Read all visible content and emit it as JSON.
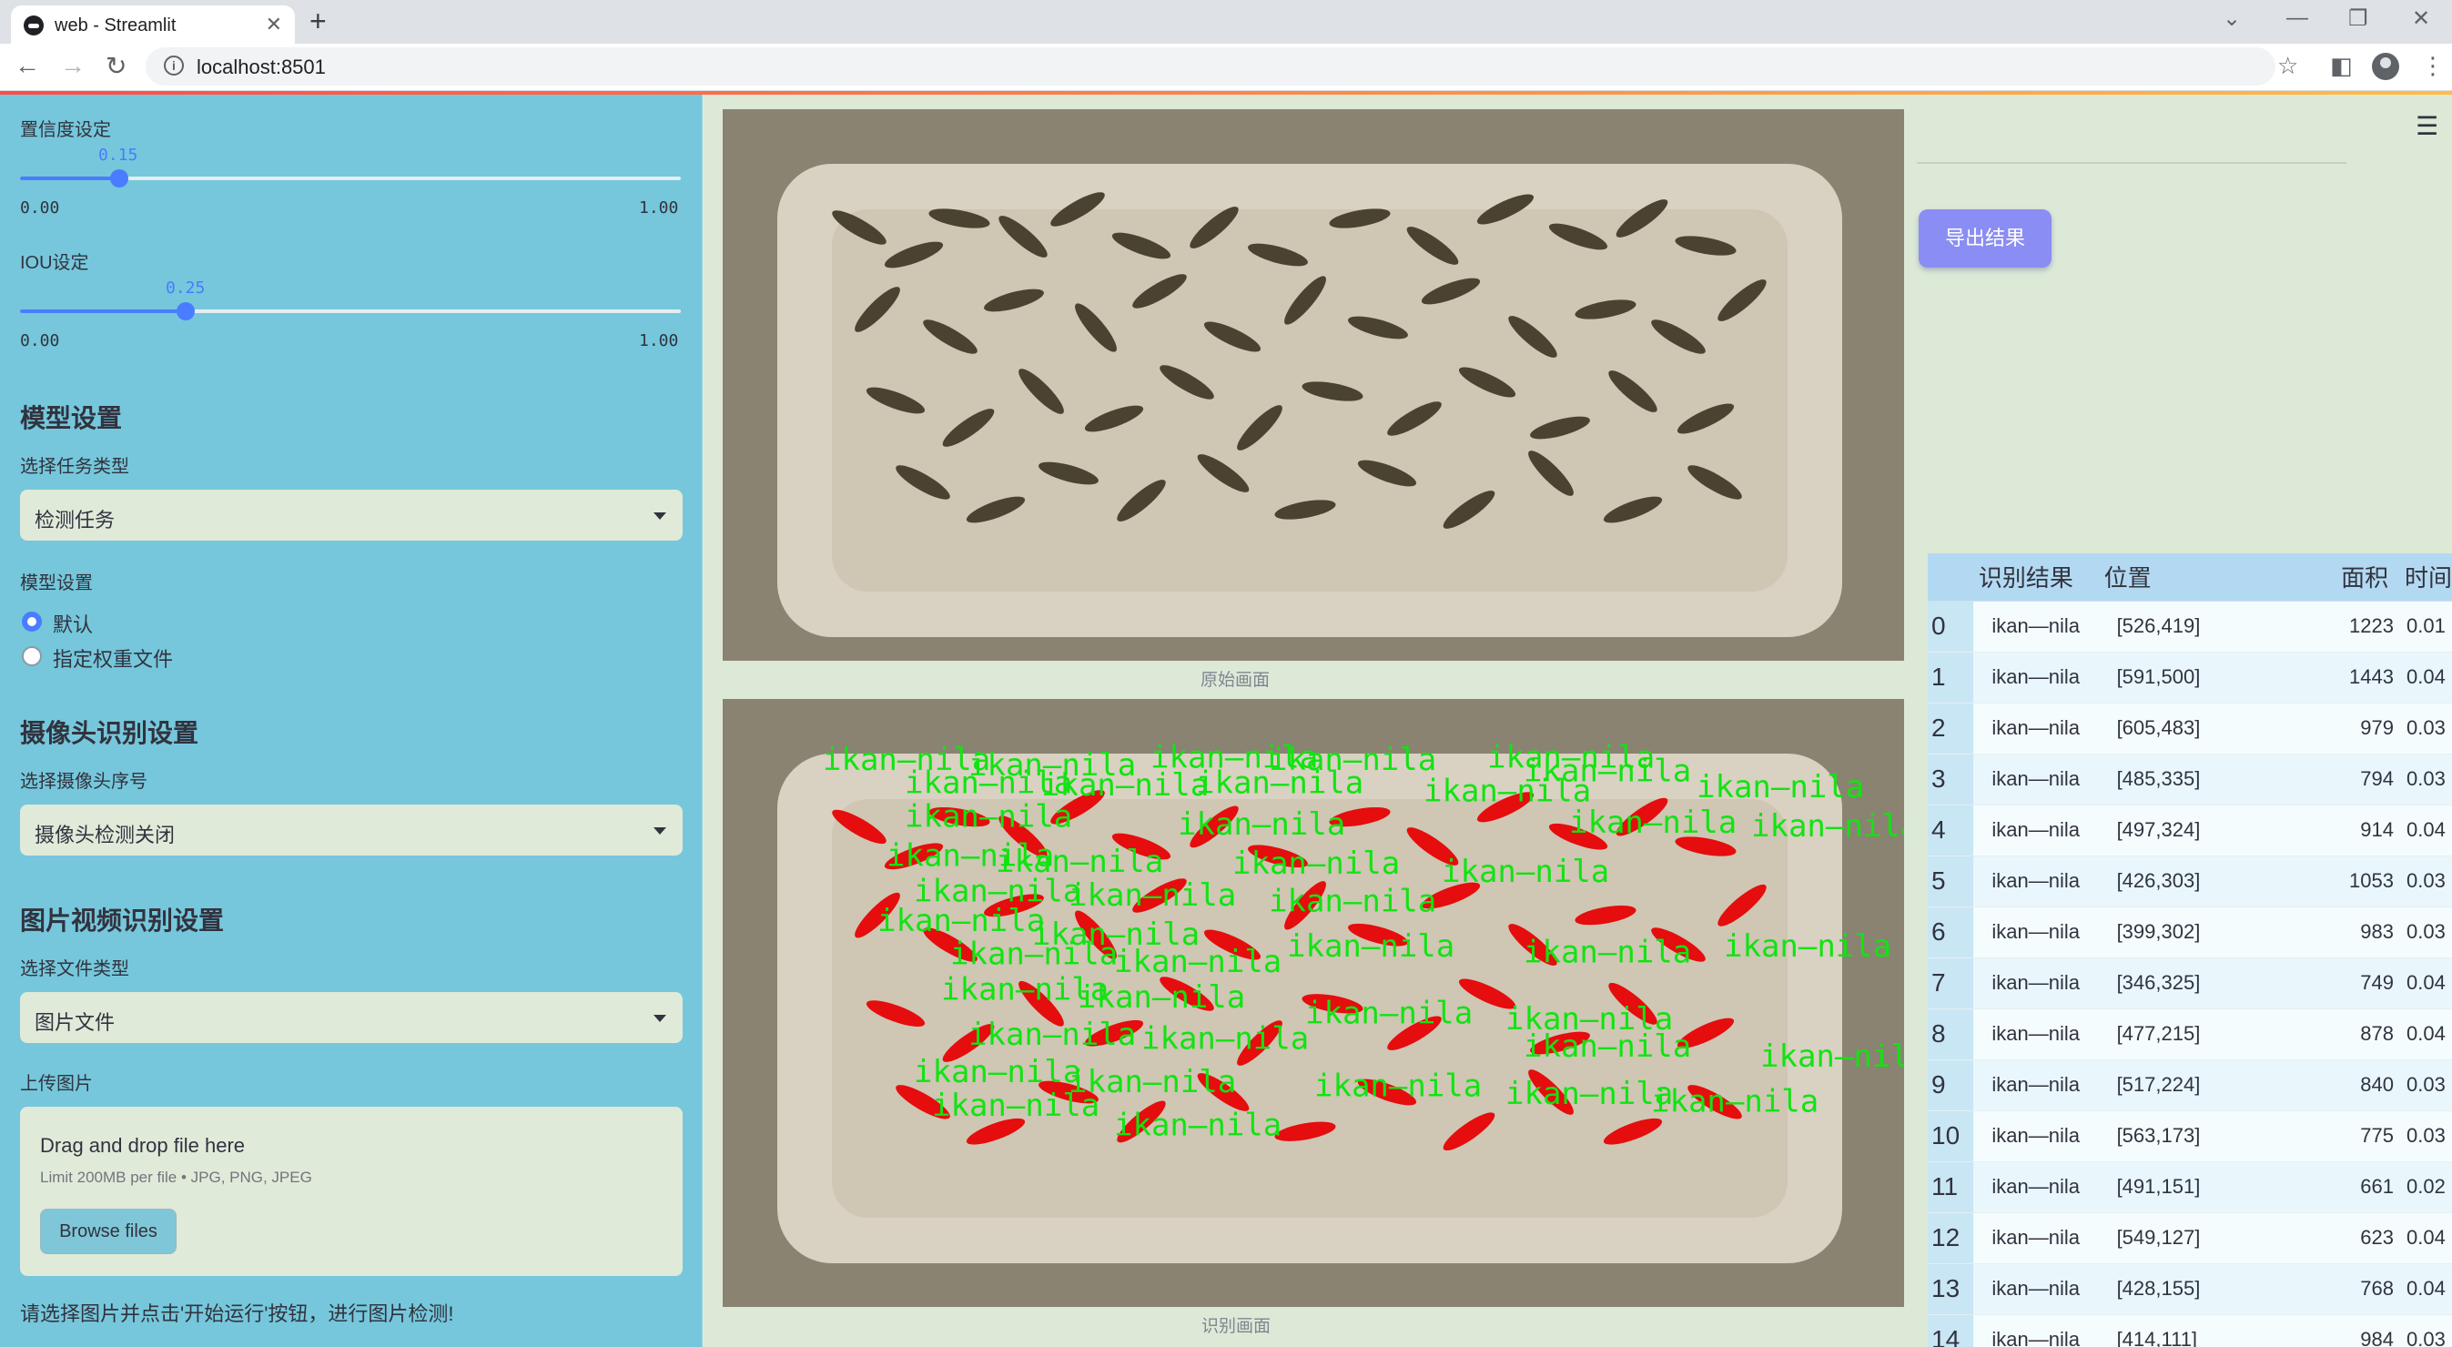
{
  "browser": {
    "tab_title": "web - Streamlit",
    "url": "localhost:8501"
  },
  "sidebar": {
    "confidence": {
      "label": "置信度设定",
      "value": "0.15",
      "fraction": 0.15,
      "min": "0.00",
      "max": "1.00"
    },
    "iou": {
      "label": "IOU设定",
      "value": "0.25",
      "fraction": 0.25,
      "min": "0.00",
      "max": "1.00"
    },
    "model_section": {
      "header": "模型设置",
      "task_label": "选择任务类型",
      "task_value": "检测任务",
      "model_label": "模型设置",
      "options": [
        "默认",
        "指定权重文件"
      ],
      "selected": 0
    },
    "camera_section": {
      "header": "摄像头识别设置",
      "camera_label": "选择摄像头序号",
      "camera_value": "摄像头检测关闭"
    },
    "media_section": {
      "header": "图片视频识别设置",
      "file_type_label": "选择文件类型",
      "file_type_value": "图片文件",
      "upload_label": "上传图片",
      "drop_text": "Drag and drop file here",
      "limit_text": "Limit 200MB per file • JPG, PNG, JPEG",
      "browse_label": "Browse files"
    },
    "hint": "请选择图片并点击'开始运行'按钮，进行图片检测!"
  },
  "main": {
    "original_caption": "原始画面",
    "result_caption": "识别画面",
    "export_label": "导出结果",
    "detection_label": "ikan—nila",
    "menu_icon": "hamburger-menu-icon"
  },
  "results": {
    "columns": [
      "",
      "识别结果",
      "位置",
      "面积",
      "时间"
    ],
    "rows": [
      [
        "0",
        "ikan—nila",
        "[526,419]",
        "1223",
        "0.01"
      ],
      [
        "1",
        "ikan—nila",
        "[591,500]",
        "1443",
        "0.04"
      ],
      [
        "2",
        "ikan—nila",
        "[605,483]",
        "979",
        "0.03"
      ],
      [
        "3",
        "ikan—nila",
        "[485,335]",
        "794",
        "0.03"
      ],
      [
        "4",
        "ikan—nila",
        "[497,324]",
        "914",
        "0.04"
      ],
      [
        "5",
        "ikan—nila",
        "[426,303]",
        "1053",
        "0.03"
      ],
      [
        "6",
        "ikan—nila",
        "[399,302]",
        "983",
        "0.03"
      ],
      [
        "7",
        "ikan—nila",
        "[346,325]",
        "749",
        "0.04"
      ],
      [
        "8",
        "ikan—nila",
        "[477,215]",
        "878",
        "0.04"
      ],
      [
        "9",
        "ikan—nila",
        "[517,224]",
        "840",
        "0.03"
      ],
      [
        "10",
        "ikan—nila",
        "[563,173]",
        "775",
        "0.03"
      ],
      [
        "11",
        "ikan—nila",
        "[491,151]",
        "661",
        "0.02"
      ],
      [
        "12",
        "ikan—nila",
        "[549,127]",
        "623",
        "0.04"
      ],
      [
        "13",
        "ikan—nila",
        "[428,155]",
        "768",
        "0.04"
      ],
      [
        "14",
        "ikan—nila",
        "[414,111]",
        "984",
        "0.03"
      ]
    ]
  },
  "colors": {
    "sidebar": "#76c7db",
    "main": "#dce9d7",
    "accent": "#4a7cff",
    "export_button": "#8a8df3",
    "mask": "#e50d0d",
    "label_text": "#12e312"
  }
}
